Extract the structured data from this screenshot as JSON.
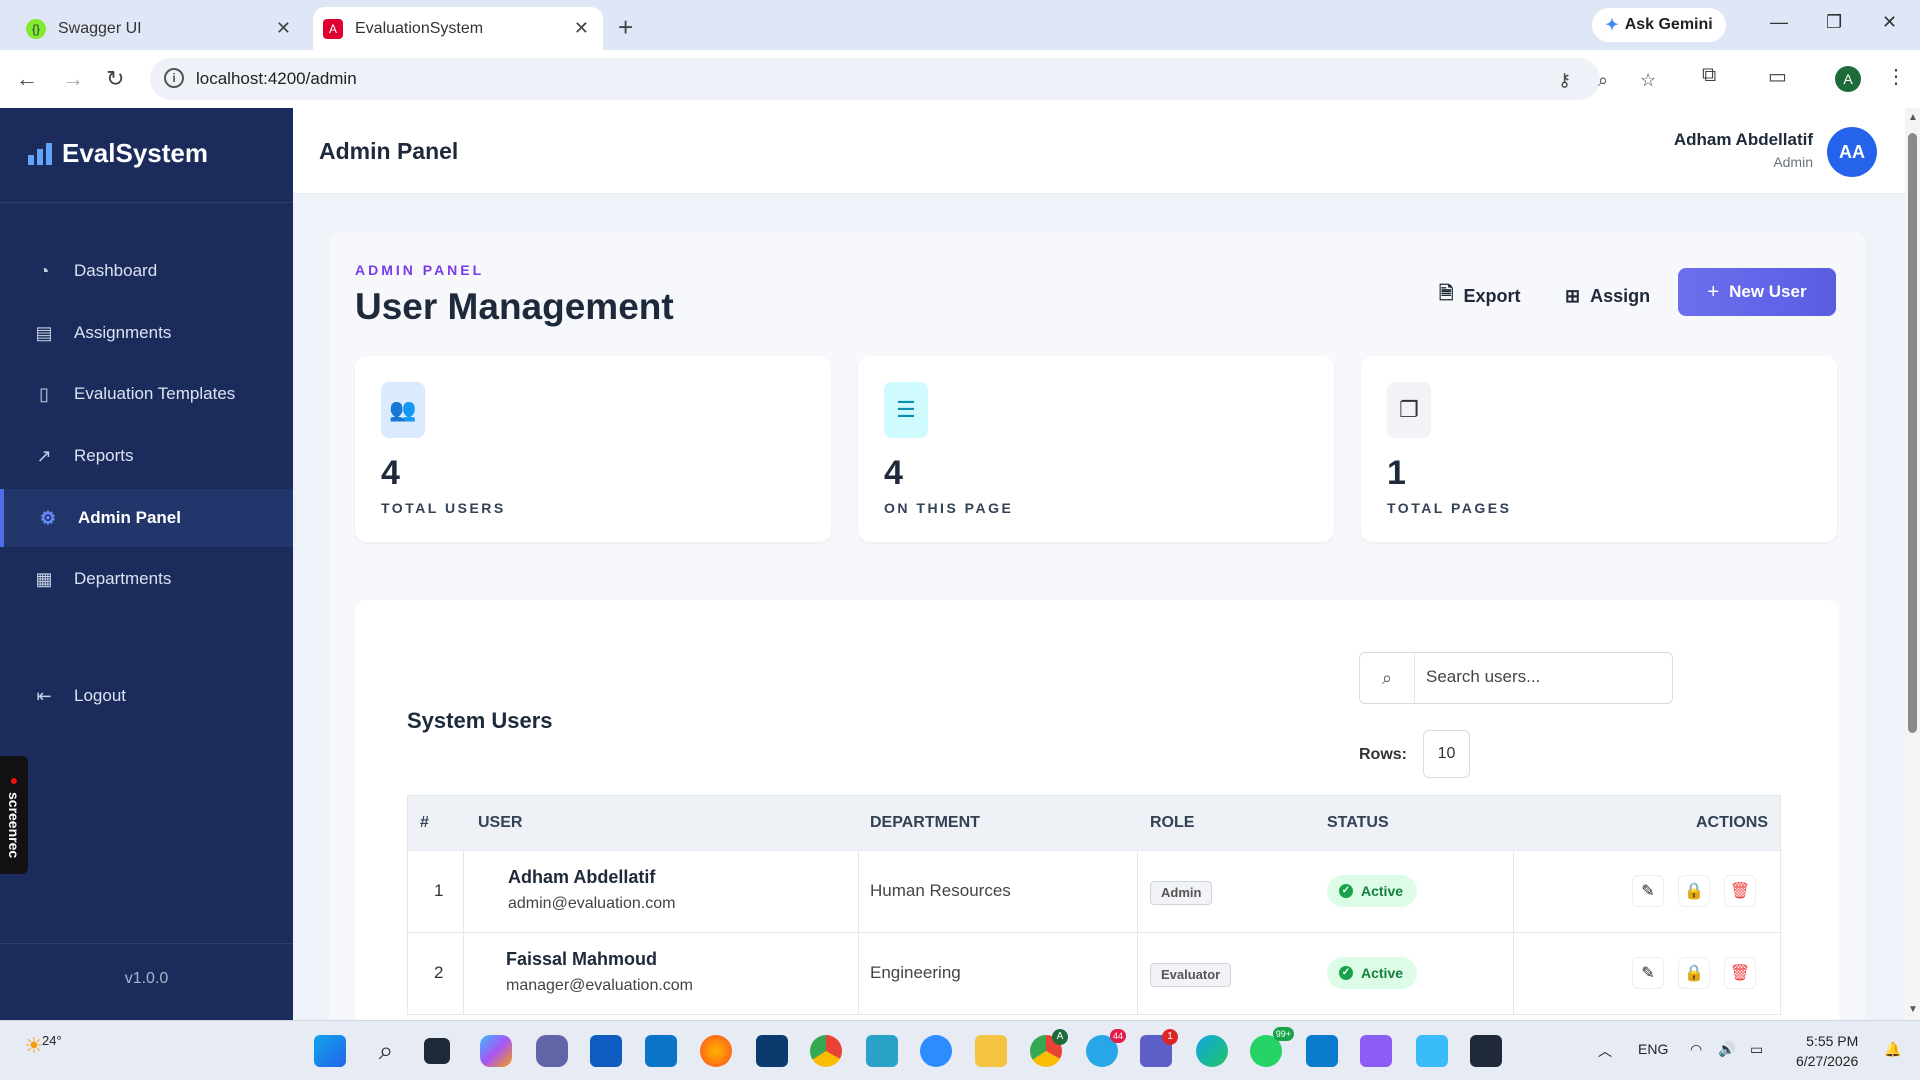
{
  "browser": {
    "tabs": [
      {
        "label": "Swagger UI",
        "active": false
      },
      {
        "label": "EvaluationSystem",
        "active": true
      }
    ],
    "gemini_label": "Ask Gemini",
    "url": "localhost:4200/admin",
    "profile_initial": "A"
  },
  "sidebar": {
    "brand": "EvalSystem",
    "items": [
      {
        "label": "Dashboard",
        "icon": "gauge-icon"
      },
      {
        "label": "Assignments",
        "icon": "clipboard-icon"
      },
      {
        "label": "Evaluation Templates",
        "icon": "document-icon"
      },
      {
        "label": "Reports",
        "icon": "chart-line-icon"
      },
      {
        "label": "Admin Panel",
        "icon": "gear-icon",
        "active": true
      },
      {
        "label": "Departments",
        "icon": "building-icon"
      }
    ],
    "logout": "Logout",
    "version": "v1.0.0",
    "screenrec": "screenrec"
  },
  "header": {
    "title": "Admin Panel",
    "user_name": "Adham Abdellatif",
    "user_role": "Admin",
    "avatar_initials": "AA"
  },
  "page": {
    "eyebrow": "ADMIN PANEL",
    "title": "User Management",
    "export_label": "Export",
    "assign_label": "Assign",
    "new_user_label": "New User"
  },
  "stats": [
    {
      "value": "4",
      "label": "TOTAL USERS",
      "icon": "users-icon"
    },
    {
      "value": "4",
      "label": "ON THIS PAGE",
      "icon": "user-list-icon"
    },
    {
      "value": "1",
      "label": "TOTAL PAGES",
      "icon": "pages-icon"
    }
  ],
  "users_table": {
    "title": "System Users",
    "search_placeholder": "Search users...",
    "rows_label": "Rows:",
    "rows_value": "10",
    "columns": [
      "#",
      "USER",
      "DEPARTMENT",
      "ROLE",
      "STATUS",
      "ACTIONS"
    ],
    "rows": [
      {
        "index": "1",
        "name": "Adham Abdellatif",
        "email": "admin@evaluation.com",
        "department": "Human Resources",
        "role": "Admin",
        "status": "Active"
      },
      {
        "index": "2",
        "name": "Faissal Mahmoud",
        "email": "manager@evaluation.com",
        "department": "Engineering",
        "role": "Evaluator",
        "status": "Active"
      }
    ]
  },
  "taskbar": {
    "weather": "24°",
    "language": "ENG",
    "time": "5:55 PM",
    "date": "6/27/2026",
    "badges": {
      "chrome": "A",
      "telegram": "44",
      "teams": "1",
      "whatsapp": "99+"
    }
  },
  "colors": {
    "sidebar_bg": "#1b2c5c",
    "accent": "#6366f1",
    "eyebrow": "#7c3aed",
    "avatar": "#2563eb",
    "status_active": "#15803d"
  }
}
